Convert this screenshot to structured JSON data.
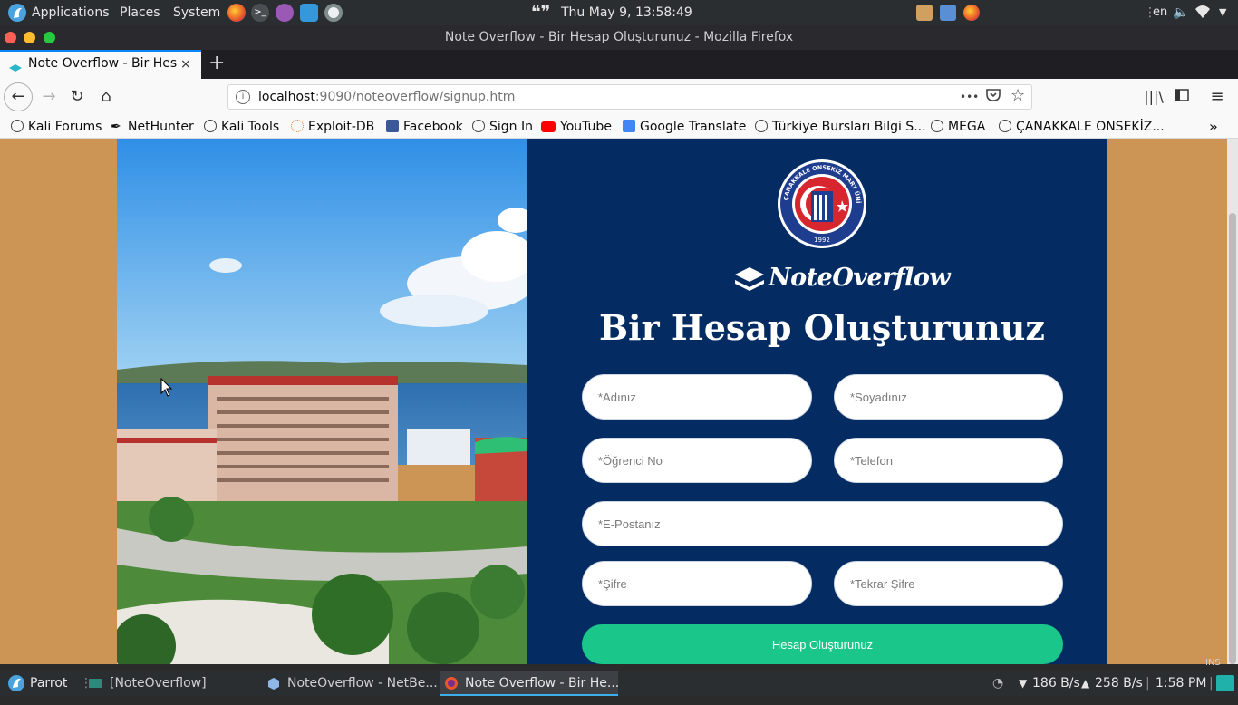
{
  "os_panel": {
    "applications": "Applications",
    "places": "Places",
    "system": "System",
    "clock": "Thu May  9, 13:58:49",
    "language": "en"
  },
  "window": {
    "title": "Note Overflow - Bir Hesap Oluşturunuz - Mozilla Firefox"
  },
  "tab": {
    "label": "Note Overflow - Bir Hesap Oluşturunuz",
    "close": "×",
    "new_tab": "+"
  },
  "nav": {
    "url_host": "localhost",
    "url_rest": ":9090/noteoverflow/signup.htm",
    "page_actions": "•••"
  },
  "bookmarks": [
    {
      "label": "Kali Forums",
      "icon": "globe-icon"
    },
    {
      "label": "NetHunter",
      "icon": "nethunter-icon"
    },
    {
      "label": "Kali Tools",
      "icon": "globe-icon"
    },
    {
      "label": "Exploit-DB",
      "icon": "exploit-db-icon"
    },
    {
      "label": "Facebook",
      "icon": "facebook-icon"
    },
    {
      "label": "Sign In",
      "icon": "globe-icon"
    },
    {
      "label": "YouTube",
      "icon": "youtube-icon"
    },
    {
      "label": "Google Translate",
      "icon": "google-translate-icon"
    },
    {
      "label": "Türkiye Bursları Bilgi S...",
      "icon": "globe-icon"
    },
    {
      "label": "MEGA",
      "icon": "globe-icon"
    },
    {
      "label": "ÇANAKKALE ONSEKİZ...",
      "icon": "globe-icon"
    }
  ],
  "page": {
    "seal_text": "ÇANAKKALE ONSEKİZ MART ÜNİVERSİTESİ",
    "seal_year": "1992",
    "brand": "NoteOverflow",
    "title": "Bir Hesap Oluşturunuz",
    "fields": {
      "first_name": "*Adınız",
      "last_name": "*Soyadınız",
      "student_no": "*Öğrenci No",
      "phone": "*Telefon",
      "email": "*E-Postanız",
      "password": "*Şifre",
      "password_repeat": "*Tekrar Şifre"
    },
    "submit": "Hesap Oluşturunuz"
  },
  "taskbar": {
    "start": "Parrot",
    "tasks": [
      "[NoteOverflow]",
      "NoteOverflow - NetBe...",
      "Note Overflow - Bir He..."
    ],
    "net_down": "186 B/s",
    "net_up": "258 B/s",
    "time": "1:58 PM",
    "ins": "INS"
  },
  "colors": {
    "page_bg": "#cd9555",
    "form_panel": "#042c63",
    "submit": "#1bc68a",
    "tab_accent": "#0a84ff"
  }
}
